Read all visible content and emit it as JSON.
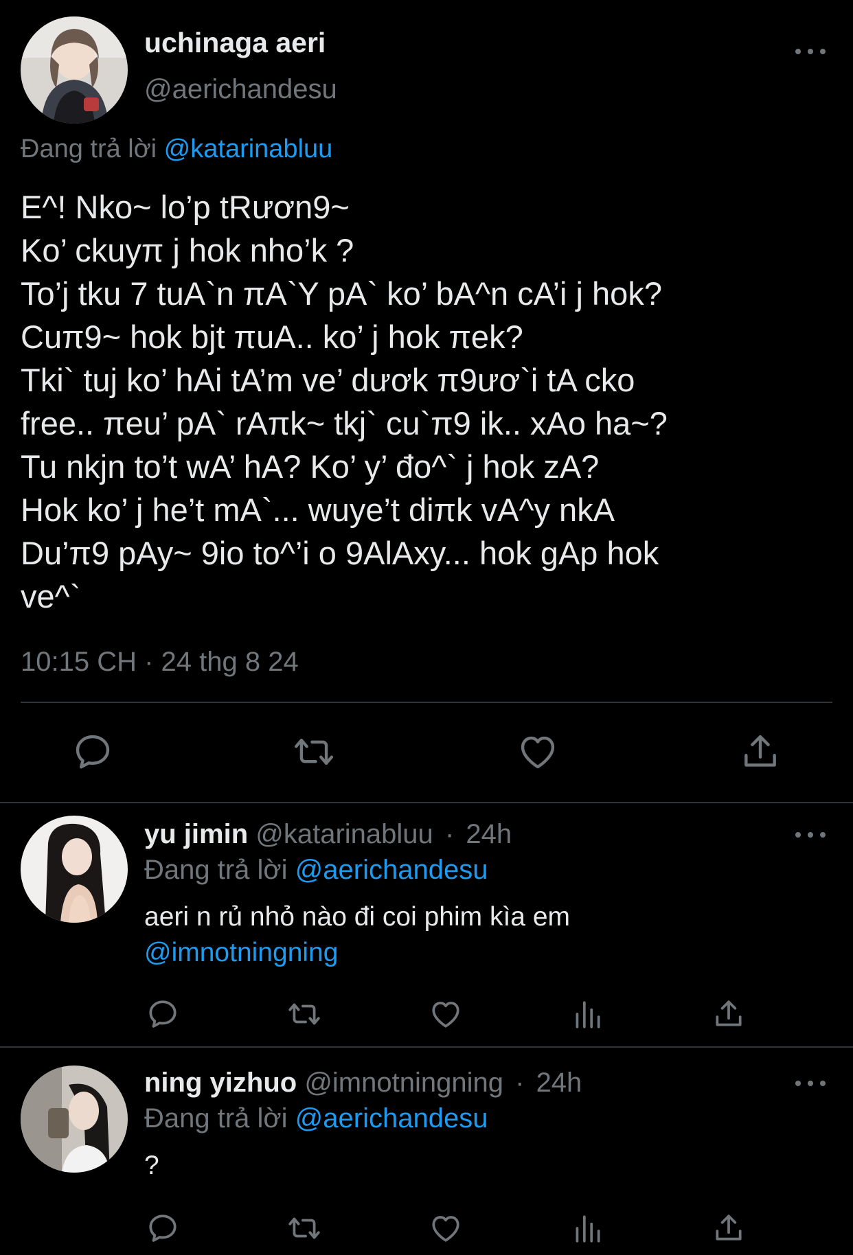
{
  "main_tweet": {
    "display_name": "uchinaga aeri",
    "handle": "@aerichandesu",
    "replying_prefix": "Đang trả lời",
    "replying_to": "@katarinabluu",
    "text_lines": [
      "E^! Nko~ lo’p tRươn9~",
      "Ko’ ckuyπ j hok nho’k ?",
      "To’j tku 7 tuA`n πA`Y pA` ko’ bA^n cA’i j hok?",
      "Cuπ9~ hok bjt πuA.. ko’ j hok πek?",
      "Tki` tuj ko’ hAi tA’m ve’ dươk π9ươ`i tA cko",
      "free.. πeu’ pA` rAπk~ tkj` cu`π9 ik.. xAo ha~?",
      "Tu nkjn to’t wA’ hA? Ko’ y’ đo^` j hok zA?",
      "Hok ko’ j he’t mA`... wuye’t diπk vA^y nkA",
      "Du’π9 pAy~ 9io to^’i o 9AlAxy... hok gAp hok",
      "ve^`"
    ],
    "timestamp": "10:15 CH · 24 thg 8 24"
  },
  "replies": [
    {
      "display_name": "yu jimin",
      "handle": "@katarinabluu",
      "time": "24h",
      "separator": "·",
      "replying_prefix": "Đang trả lời",
      "replying_to": "@aerichandesu",
      "text": "aeri n rủ nhỏ nào đi coi phim kìa em",
      "mention": "@imnotningning"
    },
    {
      "display_name": "ning yizhuo",
      "handle": "@imnotningning",
      "time": "24h",
      "separator": "·",
      "replying_prefix": "Đang trả lời",
      "replying_to": "@aerichandesu",
      "text": "?"
    }
  ],
  "colors": {
    "background": "#000000",
    "text": "#e7e9ea",
    "muted": "#71767b",
    "link": "#1d9bf0",
    "divider": "#2f3336"
  },
  "icons": {
    "main_actions": [
      "reply-icon",
      "retweet-icon",
      "like-icon",
      "share-icon"
    ],
    "reply_actions": [
      "reply-icon",
      "retweet-icon",
      "like-icon",
      "views-icon",
      "share-icon"
    ],
    "more": "more-icon"
  }
}
